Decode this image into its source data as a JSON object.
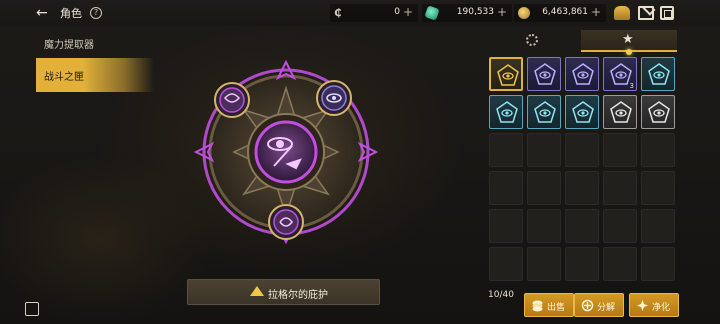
{
  "header": {
    "title": "角色",
    "help_label": "?",
    "currencies": [
      {
        "icon": "crystal-c-icon",
        "value": "0"
      },
      {
        "icon": "green-gem-icon",
        "value": "190,533"
      },
      {
        "icon": "gold-coin-icon",
        "value": "6,463,861"
      }
    ],
    "plus_label": "+",
    "top_icons": [
      "treasure-chest-icon",
      "mail-icon",
      "window-icon"
    ]
  },
  "sidebar": {
    "items": [
      {
        "label": "魔力提取器",
        "active": false
      },
      {
        "label": "战斗之匣",
        "active": true
      }
    ]
  },
  "emblem": {
    "accent": "#c04fe0",
    "frame_color": "#4d4232",
    "bless_button": "拉格尔的庇护"
  },
  "inventory": {
    "tabs": [
      {
        "icon": "gear-icon",
        "active": false
      },
      {
        "icon": "star-icon",
        "active": true
      }
    ],
    "grid_rows": 6,
    "grid_cols": 5,
    "items": [
      {
        "style": "selected",
        "icon": "gold-scroll-rune-icon"
      },
      {
        "style": "violet",
        "icon": "violet-eye-rune-icon"
      },
      {
        "style": "violet",
        "icon": "violet-eye-rune-icon"
      },
      {
        "style": "violet",
        "icon": "violet-eye-rune-icon",
        "qty": "3"
      },
      {
        "style": "teal",
        "icon": "teal-spiral-rune-icon"
      },
      {
        "style": "teal",
        "icon": "teal-eye-rune-icon"
      },
      {
        "style": "teal",
        "icon": "teal-figure-rune-icon"
      },
      {
        "style": "teal",
        "icon": "teal-eye-rune-icon"
      },
      {
        "style": "grey",
        "icon": "grey-yin-rune-icon"
      },
      {
        "style": "grey",
        "icon": "grey-spiral-rune-icon"
      }
    ],
    "count_label": "10/40",
    "actions": [
      {
        "label": "出售",
        "icon": "coin-stack-icon"
      },
      {
        "label": "分解",
        "icon": "disassemble-icon"
      },
      {
        "label": "净化",
        "icon": "purify-icon"
      }
    ]
  },
  "colors": {
    "gold_accent": "#e2b03e",
    "violet": "#c04fe0",
    "background": "#161513"
  }
}
